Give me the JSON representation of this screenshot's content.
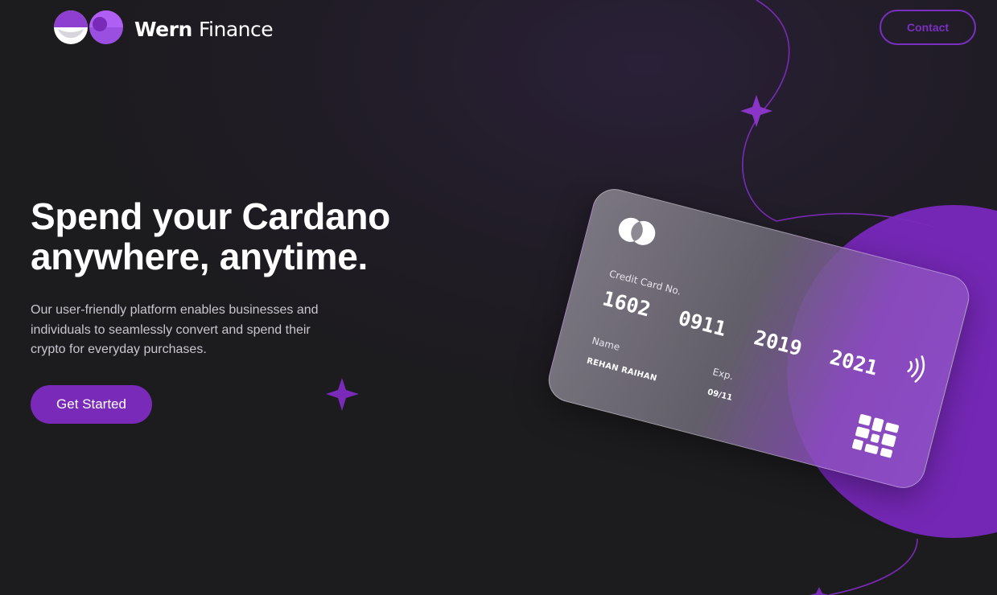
{
  "header": {
    "brand_primary": "Wern",
    "brand_secondary": "Finance",
    "logo_icon": "wern-logo-icon",
    "contact_label": "Contact"
  },
  "hero": {
    "headline_line1": "Spend your Cardano",
    "headline_line2": "anywhere, anytime.",
    "subtext": "Our user-friendly platform enables businesses and individuals to seamlessly convert and spend their crypto for everyday purchases.",
    "cta_label": "Get Started"
  },
  "card": {
    "number_label": "Credit Card No.",
    "number": "1602 0911 2019 2021",
    "name_label": "Name",
    "name": "REHAN RAIHAN",
    "exp_label": "Exp.",
    "exp": "09/11",
    "logo_icon": "card-network-logo-icon",
    "contactless_icon": "contactless-icon",
    "chip_icon": "card-chip-icon"
  },
  "colors": {
    "accent": "#7a2ab8",
    "accent_bright": "#a855f7",
    "background": "#1c1b1e",
    "text_muted": "#c9c6cf"
  }
}
